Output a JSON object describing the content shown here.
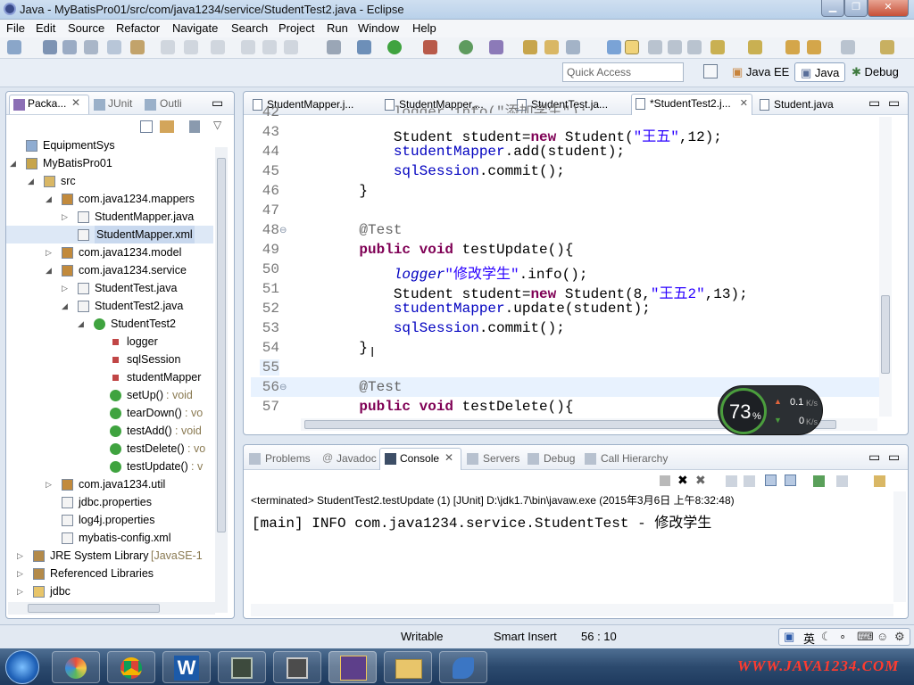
{
  "window": {
    "title": "Java - MyBatisPro01/src/com/java1234/service/StudentTest2.java - Eclipse"
  },
  "menu": [
    "File",
    "Edit",
    "Source",
    "Refactor",
    "Navigate",
    "Search",
    "Project",
    "Run",
    "Window",
    "Help"
  ],
  "quick_access": {
    "placeholder": "Quick Access"
  },
  "perspectives": {
    "javaee": "Java EE",
    "java": "Java",
    "debug": "Debug"
  },
  "left_tabs": {
    "package": "Packa...",
    "junit": "JUnit",
    "outline": "Outli"
  },
  "tree": [
    {
      "label": "EquipmentSys"
    },
    {
      "label": "MyBatisPro01"
    },
    {
      "label": "src"
    },
    {
      "label": "com.java1234.mappers"
    },
    {
      "label": "StudentMapper.java"
    },
    {
      "label": "StudentMapper.xml"
    },
    {
      "label": "com.java1234.model"
    },
    {
      "label": "com.java1234.service"
    },
    {
      "label": "StudentTest.java"
    },
    {
      "label": "StudentTest2.java"
    },
    {
      "label": "StudentTest2"
    },
    {
      "label": "logger"
    },
    {
      "label": "sqlSession"
    },
    {
      "label": "studentMapper"
    },
    {
      "label": "setUp()",
      "type": ": void"
    },
    {
      "label": "tearDown()",
      "type": ": vo"
    },
    {
      "label": "testAdd()",
      "type": ": void"
    },
    {
      "label": "testDelete()",
      "type": ": vo"
    },
    {
      "label": "testUpdate()",
      "type": ": v"
    },
    {
      "label": "com.java1234.util"
    },
    {
      "label": "jdbc.properties"
    },
    {
      "label": "log4j.properties"
    },
    {
      "label": "mybatis-config.xml"
    },
    {
      "label": "JRE System Library",
      "type": "[JavaSE-1"
    },
    {
      "label": "Referenced Libraries"
    },
    {
      "label": "jdbc"
    }
  ],
  "editor_tabs": [
    {
      "label": "StudentMapper.j..."
    },
    {
      "label": "StudentMapper...."
    },
    {
      "label": "StudentTest.ja..."
    },
    {
      "label": "*StudentTest2.j..."
    },
    {
      "label": "Student.java"
    }
  ],
  "code": [
    {
      "ln": "42",
      "text": "        logger.info(\"添加学生\");"
    },
    {
      "ln": "43",
      "a": "        Student student=",
      "kw": "new",
      "b": " Student(",
      "s": "\"王五\"",
      "c": ",12);"
    },
    {
      "ln": "44",
      "f": "        studentMapper",
      "c": ".add(student);"
    },
    {
      "ln": "45",
      "f": "        sqlSession",
      "c": ".commit();"
    },
    {
      "ln": "46",
      "c": "    }"
    },
    {
      "ln": "47",
      "c": ""
    },
    {
      "ln": "48",
      "ann": "    @Test"
    },
    {
      "ln": "49",
      "kw": "    public void",
      "c": " testUpdate(){"
    },
    {
      "ln": "50",
      "f": "        logger",
      "c": ".info(",
      "s": "\"修改学生\"",
      "d": ");"
    },
    {
      "ln": "51",
      "a": "        Student student=",
      "kw": "new",
      "b": " Student(8,",
      "s": "\"王五2\"",
      "c": ",13);"
    },
    {
      "ln": "52",
      "f": "        studentMapper",
      "c": ".update(student);"
    },
    {
      "ln": "53",
      "f": "        sqlSession",
      "c": ".commit();"
    },
    {
      "ln": "54",
      "c": "    }"
    },
    {
      "ln": "55",
      "c": ""
    },
    {
      "ln": "56",
      "ann": "    @Test"
    },
    {
      "ln": "57",
      "kw": "    public void",
      "c": " testDelete(){"
    }
  ],
  "speed_widget": {
    "percent": "73",
    "unit": "%",
    "up": "0.1",
    "down": "0",
    "rate_unit": "K/s"
  },
  "bottom_tabs": {
    "problems": "Problems",
    "javadoc": "Javadoc",
    "console": "Console",
    "servers": "Servers",
    "debug": "Debug",
    "hierarchy": "Call Hierarchy"
  },
  "console": {
    "header": "<terminated> StudentTest2.testUpdate (1) [JUnit] D:\\jdk1.7\\bin\\javaw.exe (2015年3月6日 上午8:32:48)",
    "output": "[main] INFO com.java1234.service.StudentTest - 修改学生"
  },
  "status": {
    "writable": "Writable",
    "insert": "Smart Insert",
    "position": "56 : 10"
  },
  "ime": {
    "lang": "英"
  },
  "watermark": "WWW.JAVA1234.COM"
}
